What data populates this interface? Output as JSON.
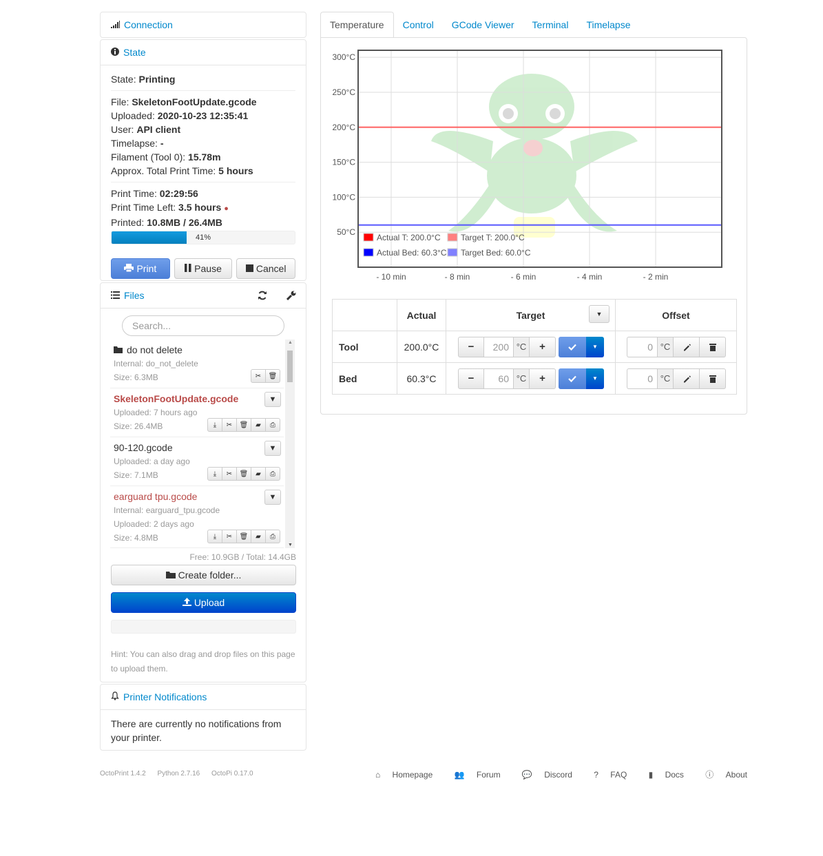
{
  "connection": {
    "title": "Connection"
  },
  "state": {
    "title": "State",
    "state_label": "State:",
    "state_value": "Printing",
    "file_label": "File:",
    "file_value": "SkeletonFootUpdate.gcode",
    "uploaded_label": "Uploaded:",
    "uploaded_value": "2020-10-23 12:35:41",
    "user_label": "User:",
    "user_value": "API client",
    "timelapse_label": "Timelapse:",
    "timelapse_value": "-",
    "filament_label": "Filament (Tool 0):",
    "filament_value": "15.78m",
    "approx_label": "Approx. Total Print Time:",
    "approx_value": "5 hours",
    "printtime_label": "Print Time:",
    "printtime_value": "02:29:56",
    "timeleft_label": "Print Time Left:",
    "timeleft_value": "3.5 hours",
    "printed_label": "Printed:",
    "printed_value": "10.8MB / 26.4MB",
    "progress": 41,
    "progress_text": "41%",
    "print_btn": "Print",
    "pause_btn": "Pause",
    "cancel_btn": "Cancel"
  },
  "files": {
    "title": "Files",
    "search_placeholder": "Search...",
    "items": [
      {
        "name": "do not delete",
        "l1": "Internal: do_not_delete",
        "l2": "Size: 6.3MB"
      },
      {
        "name": "SkeletonFootUpdate.gcode",
        "l1": "Uploaded: 7 hours ago",
        "l2": "Size: 26.4MB"
      },
      {
        "name": "90-120.gcode",
        "l1": "Uploaded: a day ago",
        "l2": "Size: 7.1MB"
      },
      {
        "name": "earguard tpu.gcode",
        "l1": "Internal: earguard_tpu.gcode",
        "l2": "Uploaded: 2 days ago",
        "l3": "Size: 4.8MB"
      }
    ],
    "free": "Free: 10.9GB / Total: 14.4GB",
    "create_folder": "Create folder...",
    "upload": "Upload",
    "hint": "Hint: You can also drag and drop files on this page to upload them."
  },
  "notifications": {
    "title": "Printer Notifications",
    "body": "There are currently no notifications from your printer."
  },
  "tabs": [
    "Temperature",
    "Control",
    "GCode Viewer",
    "Terminal",
    "Timelapse"
  ],
  "chart_data": {
    "type": "line",
    "x": [
      -11,
      -10,
      -8,
      -6,
      -4,
      -2,
      0
    ],
    "xticks": [
      "- 10 min",
      "- 8 min",
      "- 6 min",
      "- 4 min",
      "- 2 min"
    ],
    "yticks": [
      "50°C",
      "100°C",
      "150°C",
      "200°C",
      "250°C",
      "300°C"
    ],
    "ylim": [
      0,
      310
    ],
    "series": [
      {
        "name": "Actual T: 200.0°C",
        "color": "#ff0000",
        "values": [
          200,
          200,
          200,
          200,
          200,
          200,
          200
        ]
      },
      {
        "name": "Target T: 200.0°C",
        "color": "#ff8080",
        "values": [
          200,
          200,
          200,
          200,
          200,
          200,
          200
        ]
      },
      {
        "name": "Actual Bed: 60.3°C",
        "color": "#0000ff",
        "values": [
          60.3,
          60.3,
          60.3,
          60.3,
          60.3,
          60.3,
          60.3
        ]
      },
      {
        "name": "Target Bed: 60.0°C",
        "color": "#8080ff",
        "values": [
          60,
          60,
          60,
          60,
          60,
          60,
          60
        ]
      }
    ]
  },
  "temp_table": {
    "h_actual": "Actual",
    "h_target": "Target",
    "h_offset": "Offset",
    "tool": {
      "label": "Tool",
      "actual": "200.0°C",
      "target": "200",
      "offset": "0"
    },
    "bed": {
      "label": "Bed",
      "actual": "60.3°C",
      "target": "60",
      "offset": "0"
    },
    "unit": "°C"
  },
  "footer": {
    "left": [
      "OctoPrint 1.4.2",
      "Python 2.7.16",
      "OctoPi 0.17.0"
    ],
    "right": [
      "Homepage",
      "Forum",
      "Discord",
      "FAQ",
      "Docs",
      "About"
    ]
  }
}
